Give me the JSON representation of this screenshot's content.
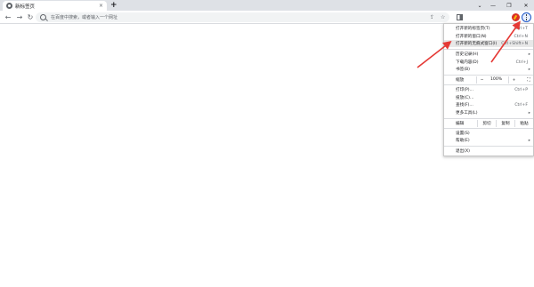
{
  "tab": {
    "title": "新标签页",
    "close_glyph": "×"
  },
  "tabstrip": {
    "new_tab_glyph": "+",
    "dropdown_glyph": "⌄",
    "minimize_glyph": "—",
    "restore_glyph": "❐",
    "close_glyph": "✕"
  },
  "toolbar": {
    "back_glyph": "←",
    "forward_glyph": "→",
    "reload_glyph": "↻"
  },
  "omnibox": {
    "placeholder": "在百度中搜索，或者输入一个网址",
    "share_glyph": "⇪",
    "star_glyph": "☆"
  },
  "menu": {
    "new_tab": {
      "label": "打开新的标签页(T)",
      "shortcut": "Ctrl+T"
    },
    "new_window": {
      "label": "打开新的窗口(N)",
      "shortcut": "Ctrl+N"
    },
    "incognito": {
      "label": "打开新的无痕式窗口(I)",
      "shortcut": "Ctrl+Shift+N"
    },
    "history": {
      "label": "历史记录(H)"
    },
    "downloads": {
      "label": "下载内容(D)",
      "shortcut": "Ctrl+J"
    },
    "bookmarks": {
      "label": "书签(B)"
    },
    "zoom": {
      "label": "缩放",
      "minus": "−",
      "value": "100%",
      "plus": "+",
      "fullscreen": "⛶"
    },
    "print": {
      "label": "打印(P)...",
      "shortcut": "Ctrl+P"
    },
    "cast": {
      "label": "投放(C)..."
    },
    "find": {
      "label": "查找(F)...",
      "shortcut": "Ctrl+F"
    },
    "more_tools": {
      "label": "更多工具(L)"
    },
    "edit": {
      "label": "编辑",
      "cut": "剪切",
      "copy": "复制",
      "paste": "粘贴"
    },
    "settings": {
      "label": "设置(S)"
    },
    "help": {
      "label": "帮助(E)"
    },
    "exit": {
      "label": "退出(X)"
    },
    "submenu_arrow": "▸"
  },
  "colors": {
    "annotation_arrow": "#e53935",
    "menu_button_ring": "#1a56c8"
  }
}
